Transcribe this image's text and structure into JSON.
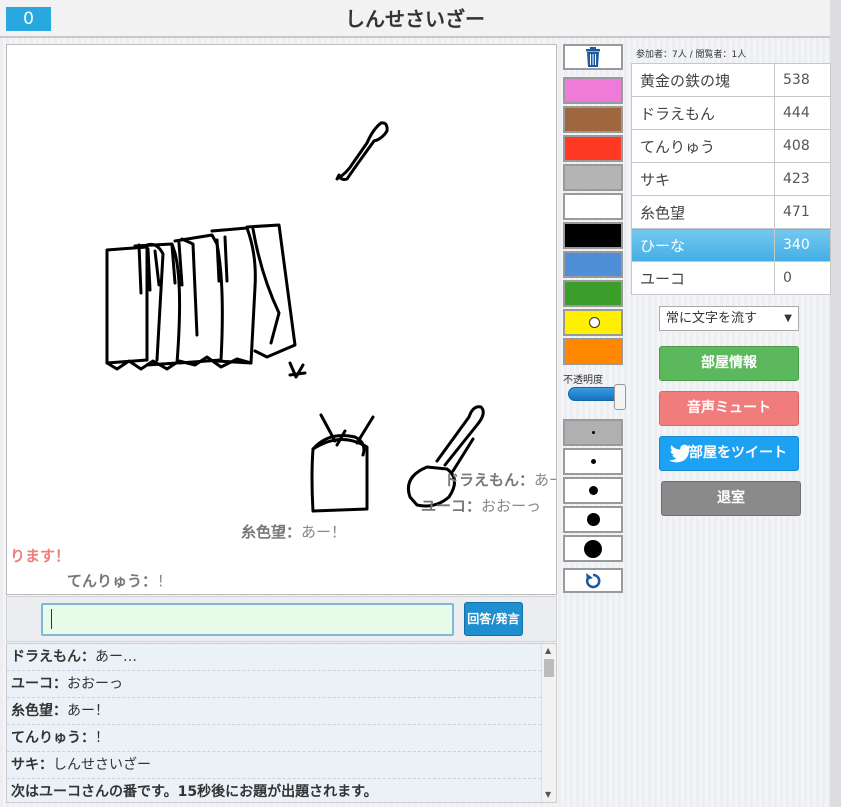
{
  "header": {
    "round_counter": "0",
    "title": "しんせさいざー"
  },
  "canvas": {
    "floating_messages": [
      {
        "name": "ドラえもん",
        "text": "あー…"
      },
      {
        "name": "ユーコ",
        "text": "おおーっ"
      },
      {
        "name": "糸色望",
        "text": "あー！"
      },
      {
        "name": "てんりゅう",
        "text": "！"
      }
    ],
    "system_fragment": "ります！"
  },
  "input": {
    "value": "",
    "send_label": "回答/発言"
  },
  "log": [
    {
      "name": "ドラえもん",
      "text": "あー…",
      "separator": "：",
      "system": false
    },
    {
      "name": "ユーコ",
      "text": "おおーっ",
      "separator": "：",
      "system": false
    },
    {
      "name": "糸色望",
      "text": "あー！",
      "separator": "：",
      "system": false
    },
    {
      "name": "てんりゅう",
      "text": "！",
      "separator": "：",
      "system": false
    },
    {
      "name": "サキ",
      "text": "しんせさいざー",
      "separator": "：",
      "system": false
    },
    {
      "name": "",
      "text": "次はユーコさんの番です。15秒後にお題が出題されます。",
      "separator": "",
      "system": true
    }
  ],
  "palette": {
    "colors": [
      "#ef7bd9",
      "#a0663d",
      "#ff3a24",
      "#b4b4b4",
      "#ffffff",
      "#000000",
      "#4f8ed8",
      "#3b9e2b",
      "#ffef00",
      "#ff8800"
    ],
    "selected_color": "#ffef00",
    "opacity_label": "不透明度",
    "opacity_value": 1.0,
    "brush_sizes": [
      "tiny",
      "small",
      "medium",
      "large",
      "xlarge"
    ],
    "selected_size": "tiny",
    "icons": {
      "clear": "trash-icon",
      "undo": "undo-icon"
    }
  },
  "players": {
    "stats": "参加者：7人 / 閲覧者：1人",
    "list": [
      {
        "name": "黄金の鉄の塊",
        "score": "538"
      },
      {
        "name": "ドラえもん",
        "score": "444"
      },
      {
        "name": "てんりゅう",
        "score": "408"
      },
      {
        "name": "サキ",
        "score": "423"
      },
      {
        "name": "糸色望",
        "score": "471"
      },
      {
        "name": "ひーな",
        "score": "340",
        "current": true
      },
      {
        "name": "ユーコ",
        "score": "0"
      }
    ]
  },
  "controls": {
    "text_mode": "常に文字を流す",
    "room_info": "部屋情報",
    "mute": "音声ミュート",
    "tweet": "部屋をツイート",
    "exit": "退室"
  }
}
